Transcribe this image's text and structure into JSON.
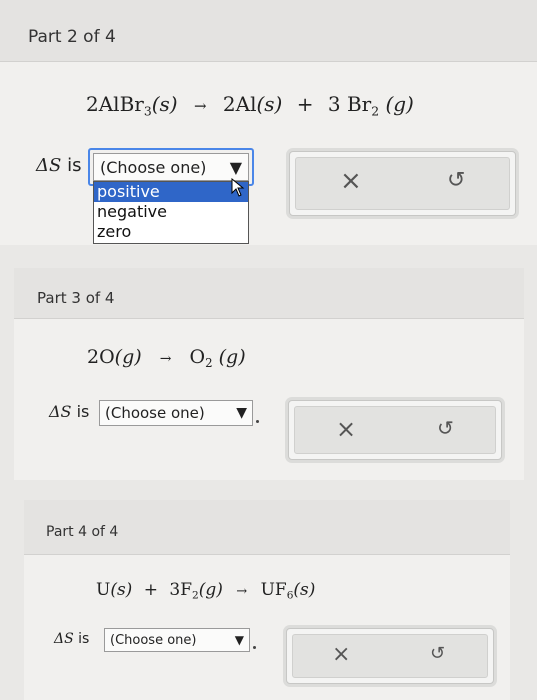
{
  "part2": {
    "title": "Part 2 of 4",
    "equation": {
      "lhs_coef": "2",
      "lhs_species": "AlBr",
      "lhs_sub": "3",
      "lhs_state": "(s)",
      "arrow": "→",
      "p1_coef": "2",
      "p1_species": "Al",
      "p1_state": "(s)",
      "plus": "+",
      "p2_coef": "3",
      "p2_species": "Br",
      "p2_sub": "2",
      "p2_state": "(g)"
    },
    "delta": "ΔS",
    "is": "is",
    "select_value": "(Choose one)",
    "options": [
      "positive",
      "negative",
      "zero"
    ],
    "highlighted_option": "positive"
  },
  "part3": {
    "title": "Part 3 of 4",
    "equation": {
      "lhs_coef": "2",
      "lhs_species": "O",
      "lhs_state": "(g)",
      "arrow": "→",
      "p1_species": "O",
      "p1_sub": "2",
      "p1_state": "(g)"
    },
    "delta": "ΔS",
    "is": "is",
    "select_value": "(Choose one)"
  },
  "part4": {
    "title": "Part 4 of 4",
    "equation": {
      "r1_species": "U",
      "r1_state": "(s)",
      "plus": "+",
      "r2_coef": "3",
      "r2_species": "F",
      "r2_sub": "2",
      "r2_state": "(g)",
      "arrow": "→",
      "p1_species": "UF",
      "p1_sub": "6",
      "p1_state": "(s)"
    },
    "delta": "ΔS",
    "is": "is",
    "select_value": "(Choose one)"
  },
  "icons": {
    "arrow_down": "▼",
    "clear": "×",
    "undo": "↺"
  }
}
